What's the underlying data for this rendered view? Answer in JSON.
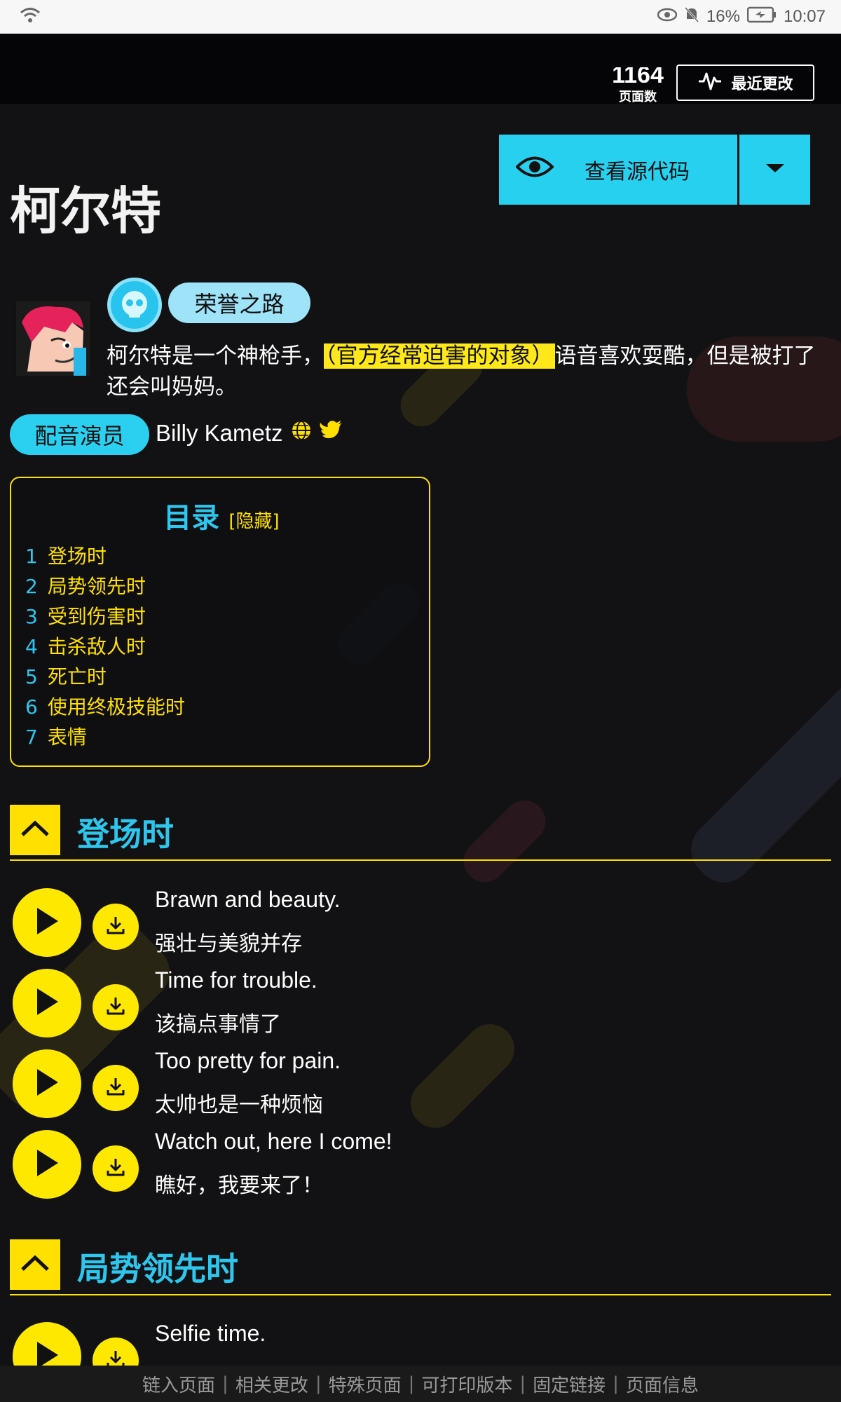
{
  "status_bar": {
    "battery": "16%",
    "time": "10:07"
  },
  "header": {
    "page_count_number": "1164",
    "page_count_label": "页面数",
    "recent_changes_label": "最近更改"
  },
  "page": {
    "title": "柯尔特",
    "view_source_label": "查看源代码"
  },
  "profile": {
    "tag": "荣誉之路",
    "description_before": "柯尔特是一个神枪手，",
    "description_highlight": "（官方经常迫害的对象）",
    "description_after": "语音喜欢耍酷，但是被打了还会叫妈妈。",
    "voice_actor_label": "配音演员",
    "voice_actor_name": "Billy Kametz"
  },
  "toc": {
    "title": "目录",
    "toggle": "[隐藏]",
    "items": [
      {
        "num": "1",
        "label": "登场时"
      },
      {
        "num": "2",
        "label": "局势领先时"
      },
      {
        "num": "3",
        "label": "受到伤害时"
      },
      {
        "num": "4",
        "label": "击杀敌人时"
      },
      {
        "num": "5",
        "label": "死亡时"
      },
      {
        "num": "6",
        "label": "使用终极技能时"
      },
      {
        "num": "7",
        "label": "表情"
      }
    ]
  },
  "sections": [
    {
      "title": "登场时",
      "lines": [
        {
          "en": "Brawn and beauty.",
          "cn": "强壮与美貌并存"
        },
        {
          "en": "Time for trouble.",
          "cn": "该搞点事情了"
        },
        {
          "en": "Too pretty for pain.",
          "cn": "太帅也是一种烦恼"
        },
        {
          "en": "Watch out, here I come!",
          "cn": "瞧好，我要来了！"
        }
      ]
    },
    {
      "title": "局势领先时",
      "lines": [
        {
          "en": "Selfie time.",
          "cn": ""
        }
      ]
    }
  ],
  "footer": {
    "links": [
      "链入页面",
      "相关更改",
      "特殊页面",
      "可打印版本",
      "固定链接",
      "页面信息"
    ]
  },
  "colors": {
    "accent_cyan": "#28d0f0",
    "accent_yellow": "#ffe800",
    "background": "#121214"
  },
  "icons": [
    "wifi-icon",
    "eye-icon",
    "mute-icon",
    "battery-icon",
    "activity-icon",
    "chevron-down-icon",
    "skull-icon",
    "globe-icon",
    "twitter-icon",
    "chevron-up-icon",
    "play-icon",
    "download-icon"
  ]
}
